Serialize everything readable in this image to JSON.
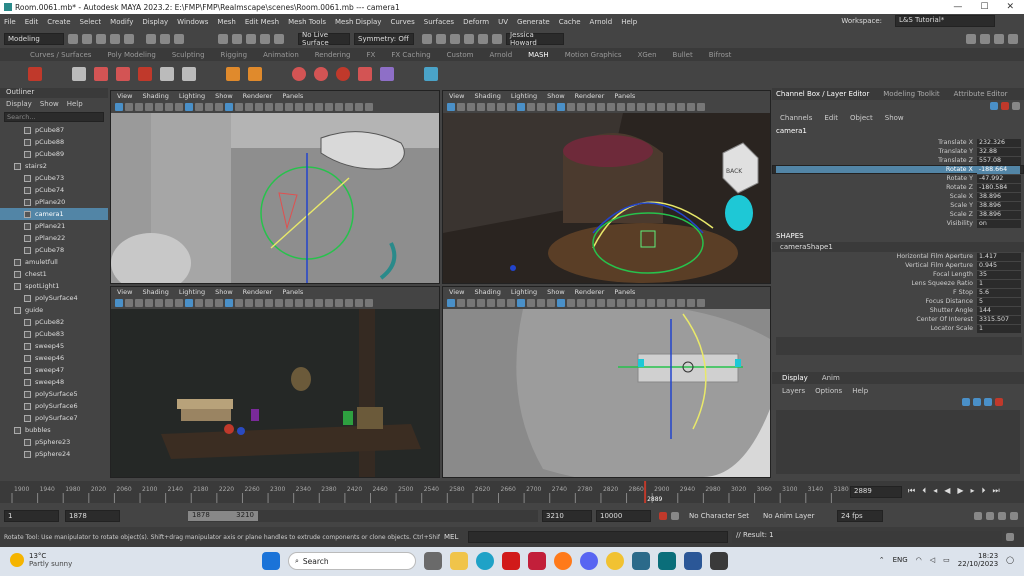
{
  "title": "Room.0061.mb* - Autodesk MAYA 2023.2: E:\\FMP\\FMP\\Realmscape\\scenes\\Room.0061.mb   ---   camera1",
  "menu": [
    "File",
    "Edit",
    "Create",
    "Select",
    "Modify",
    "Display",
    "Windows",
    "Mesh",
    "Edit Mesh",
    "Mesh Tools",
    "Mesh Display",
    "Curves",
    "Surfaces",
    "Deform",
    "UV",
    "Generate",
    "Cache",
    "Arnold",
    "Help"
  ],
  "workspace": {
    "label": "Workspace:",
    "value": "L&S Tutorial*"
  },
  "status": {
    "mode": "Modeling",
    "live": "No Live Surface",
    "symmetry": "Symmetry: Off",
    "user": "Jessica Howard"
  },
  "shelf_tabs": [
    "Curves / Surfaces",
    "Poly Modeling",
    "Sculpting",
    "Rigging",
    "Animation",
    "Rendering",
    "FX",
    "FX Caching",
    "Custom",
    "Arnold",
    "MASH",
    "Motion Graphics",
    "XGen",
    "Bullet",
    "Bifrost"
  ],
  "shelf_active": "MASH",
  "outliner": {
    "title": "Outliner",
    "menu": [
      "Display",
      "Show",
      "Help"
    ],
    "search": "Search...",
    "items": [
      {
        "label": "pCube87",
        "grp": false
      },
      {
        "label": "pCube88",
        "grp": false
      },
      {
        "label": "pCube89",
        "grp": false
      },
      {
        "label": "stairs2",
        "grp": true
      },
      {
        "label": "pCube73",
        "grp": false
      },
      {
        "label": "pCube74",
        "grp": false
      },
      {
        "label": "pPlane20",
        "grp": false
      },
      {
        "label": "camera1",
        "grp": false,
        "selected": true
      },
      {
        "label": "pPlane21",
        "grp": false
      },
      {
        "label": "pPlane22",
        "grp": false
      },
      {
        "label": "pCube78",
        "grp": false
      },
      {
        "label": "amuletfull",
        "grp": true
      },
      {
        "label": "chest1",
        "grp": true
      },
      {
        "label": "spotLight1",
        "grp": true
      },
      {
        "label": "polySurface4",
        "grp": false
      },
      {
        "label": "guide",
        "grp": true
      },
      {
        "label": "pCube82",
        "grp": false
      },
      {
        "label": "pCube83",
        "grp": false
      },
      {
        "label": "sweep45",
        "grp": false
      },
      {
        "label": "sweep46",
        "grp": false
      },
      {
        "label": "sweep47",
        "grp": false
      },
      {
        "label": "sweep48",
        "grp": false
      },
      {
        "label": "polySurface5",
        "grp": false
      },
      {
        "label": "polySurface6",
        "grp": false
      },
      {
        "label": "polySurface7",
        "grp": false
      },
      {
        "label": "bubbles",
        "grp": true
      },
      {
        "label": "pSphere23",
        "grp": false
      },
      {
        "label": "pSphere24",
        "grp": false
      }
    ]
  },
  "viewport_menu": [
    "View",
    "Shading",
    "Lighting",
    "Show",
    "Renderer",
    "Panels"
  ],
  "viewcube_label": "BACK",
  "channel_box": {
    "tabs": [
      "Channel Box / Layer Editor",
      "Modeling Toolkit",
      "Attribute Editor"
    ],
    "menu": [
      "Channels",
      "Edit",
      "Object",
      "Show"
    ],
    "object": "camera1",
    "attrs": [
      {
        "name": "Translate X",
        "value": "232.326"
      },
      {
        "name": "Translate Y",
        "value": "32.88"
      },
      {
        "name": "Translate Z",
        "value": "557.08"
      },
      {
        "name": "Rotate X",
        "value": "-188.664",
        "selected": true
      },
      {
        "name": "Rotate Y",
        "value": "-47.992"
      },
      {
        "name": "Rotate Z",
        "value": "-180.584"
      },
      {
        "name": "Scale X",
        "value": "38.896"
      },
      {
        "name": "Scale Y",
        "value": "38.896"
      },
      {
        "name": "Scale Z",
        "value": "38.896"
      },
      {
        "name": "Visibility",
        "value": "on"
      }
    ],
    "shapes_label": "SHAPES",
    "shape_name": "cameraShape1",
    "shape_attrs": [
      {
        "name": "Horizontal Film Aperture",
        "value": "1.417"
      },
      {
        "name": "Vertical Film Aperture",
        "value": "0.945"
      },
      {
        "name": "Focal Length",
        "value": "35"
      },
      {
        "name": "Lens Squeeze Ratio",
        "value": "1"
      },
      {
        "name": "F Stop",
        "value": "5.6"
      },
      {
        "name": "Focus Distance",
        "value": "5"
      },
      {
        "name": "Shutter Angle",
        "value": "144"
      },
      {
        "name": "Center Of Interest",
        "value": "3315.507"
      },
      {
        "name": "Locator Scale",
        "value": "1"
      }
    ],
    "layer_tabs": [
      "Display",
      "Anim"
    ],
    "layer_menu": [
      "Layers",
      "Options",
      "Help"
    ]
  },
  "timeline": {
    "ticks": [
      "1900",
      "1940",
      "1980",
      "2020",
      "2060",
      "2100",
      "2140",
      "2180",
      "2220",
      "2260",
      "2300",
      "2340",
      "2380",
      "2420",
      "2460",
      "2500",
      "2540",
      "2580",
      "2620",
      "2660",
      "2700",
      "2740",
      "2780",
      "2820",
      "2860",
      "2900",
      "2940",
      "2980",
      "3020",
      "3060",
      "3100",
      "3140",
      "3180"
    ],
    "current": "2889",
    "current_field": "2889"
  },
  "range": {
    "start": "1",
    "anim_start": "1878",
    "range_start": "1878",
    "range_end": "3210",
    "anim_end": "3210",
    "end": "10000",
    "character": "No Character Set",
    "anim_layer": "No Anim Layer",
    "fps": "24 fps"
  },
  "helpline": {
    "text": "Rotate Tool: Use manipulator to rotate object(s). Shift+drag manipulator axis or plane handles to extrude components or clone objects. Ctrl+Shift+LMB+d",
    "mel": "MEL",
    "result": "// Result: 1"
  },
  "taskbar": {
    "temp": "13°C",
    "weather": "Partly sunny",
    "search": "Search",
    "time": "18:23",
    "date": "22/10/2023",
    "lang": "ENG"
  },
  "colors": {
    "selected": "#5285a6",
    "mash": "#ffffff",
    "keyred": "#c0392b"
  }
}
